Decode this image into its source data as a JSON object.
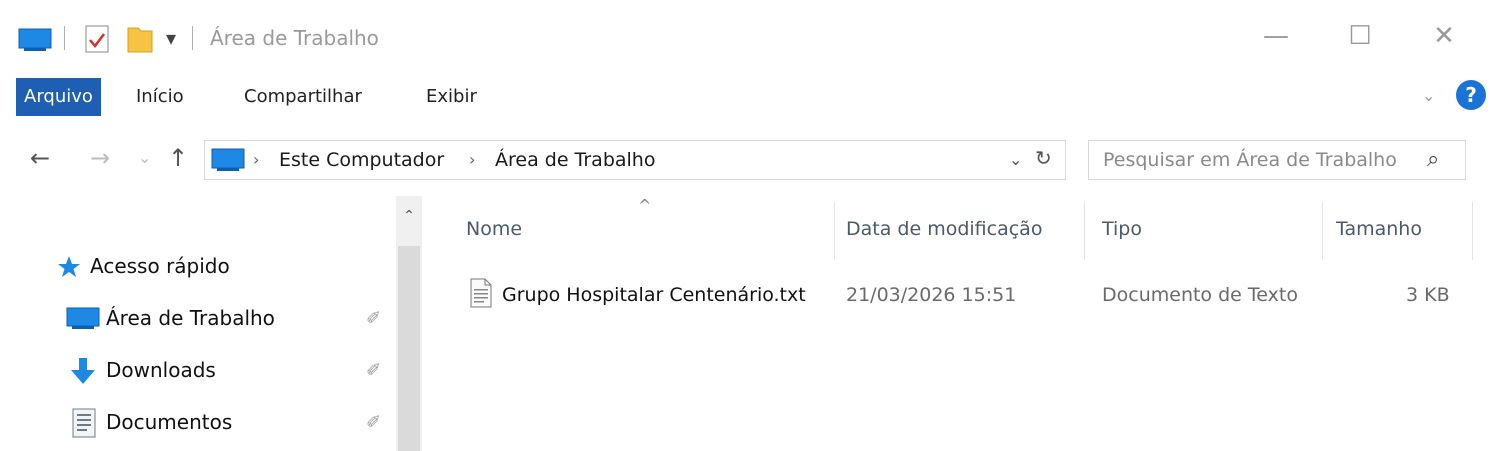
{
  "window": {
    "title": "Área de Trabalho",
    "minimize_glyph": "—",
    "maximize_glyph": "☐",
    "close_glyph": "✕"
  },
  "quick_access_toolbar": {
    "icons": [
      "computer-icon",
      "properties-checklist-icon",
      "new-folder-icon",
      "customize-dropdown-icon"
    ],
    "dropdown_glyph": "▾"
  },
  "ribbon": {
    "tabs": [
      {
        "label": "Arquivo",
        "active": true
      },
      {
        "label": "Início",
        "active": false
      },
      {
        "label": "Compartilhar",
        "active": false
      },
      {
        "label": "Exibir",
        "active": false
      }
    ],
    "expand_glyph": "⌄",
    "help_label": "?"
  },
  "navigation": {
    "back_glyph": "←",
    "forward_glyph": "→",
    "recent_glyph": "⌄",
    "up_glyph": "↑",
    "breadcrumb": [
      "Este Computador",
      "Área de Trabalho"
    ],
    "crumb_separator": "›",
    "refresh_glyph": "↻",
    "address_dropdown_glyph": "⌄",
    "search_placeholder": "Pesquisar em Área de Trabalho",
    "search_glyph": "⌕"
  },
  "nav_pane": {
    "quick_access_label": "Acesso rápido",
    "items": [
      {
        "label": "Área de Trabalho",
        "icon": "desktop-icon",
        "pinned": true
      },
      {
        "label": "Downloads",
        "icon": "downloads-icon",
        "pinned": true
      },
      {
        "label": "Documentos",
        "icon": "documents-icon",
        "pinned": true
      }
    ],
    "pin_glyph": "✐",
    "scroll_up_glyph": "⌃"
  },
  "file_list": {
    "sort_glyph": "^",
    "columns": [
      "Nome",
      "Data de modificação",
      "Tipo",
      "Tamanho"
    ],
    "rows": [
      {
        "name": "Grupo Hospitalar Centenário.txt",
        "modified": "21/03/2026 15:51",
        "type": "Documento de Texto",
        "size": "3 KB",
        "icon": "text-file-icon"
      }
    ]
  },
  "colors": {
    "accent": "#1f5fb3",
    "help": "#1a73d9",
    "folder_blue": "#1e88e5",
    "folder_yellow": "#f6c343"
  }
}
